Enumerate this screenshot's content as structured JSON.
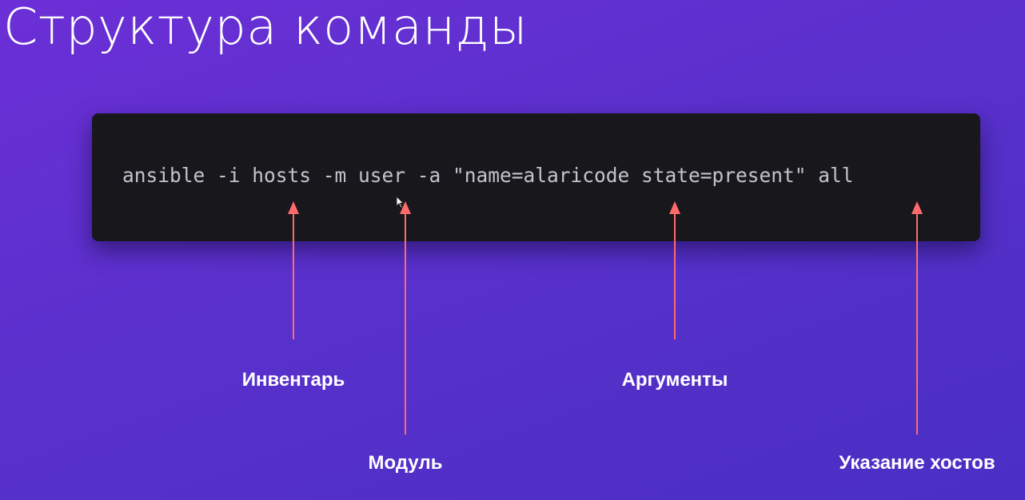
{
  "title": "Структура команды",
  "command": "ansible -i hosts -m user -a \"name=alaricode state=present\" all",
  "annotations": {
    "inventory": "Инвентарь",
    "module": "Модуль",
    "arguments": "Аргументы",
    "hosts": "Указание хостов"
  },
  "colors": {
    "background_start": "#6b2fd6",
    "background_end": "#4a2fc4",
    "code_background": "#18171c",
    "code_text": "#c3c3cb",
    "arrow": "#ff6b6b"
  }
}
